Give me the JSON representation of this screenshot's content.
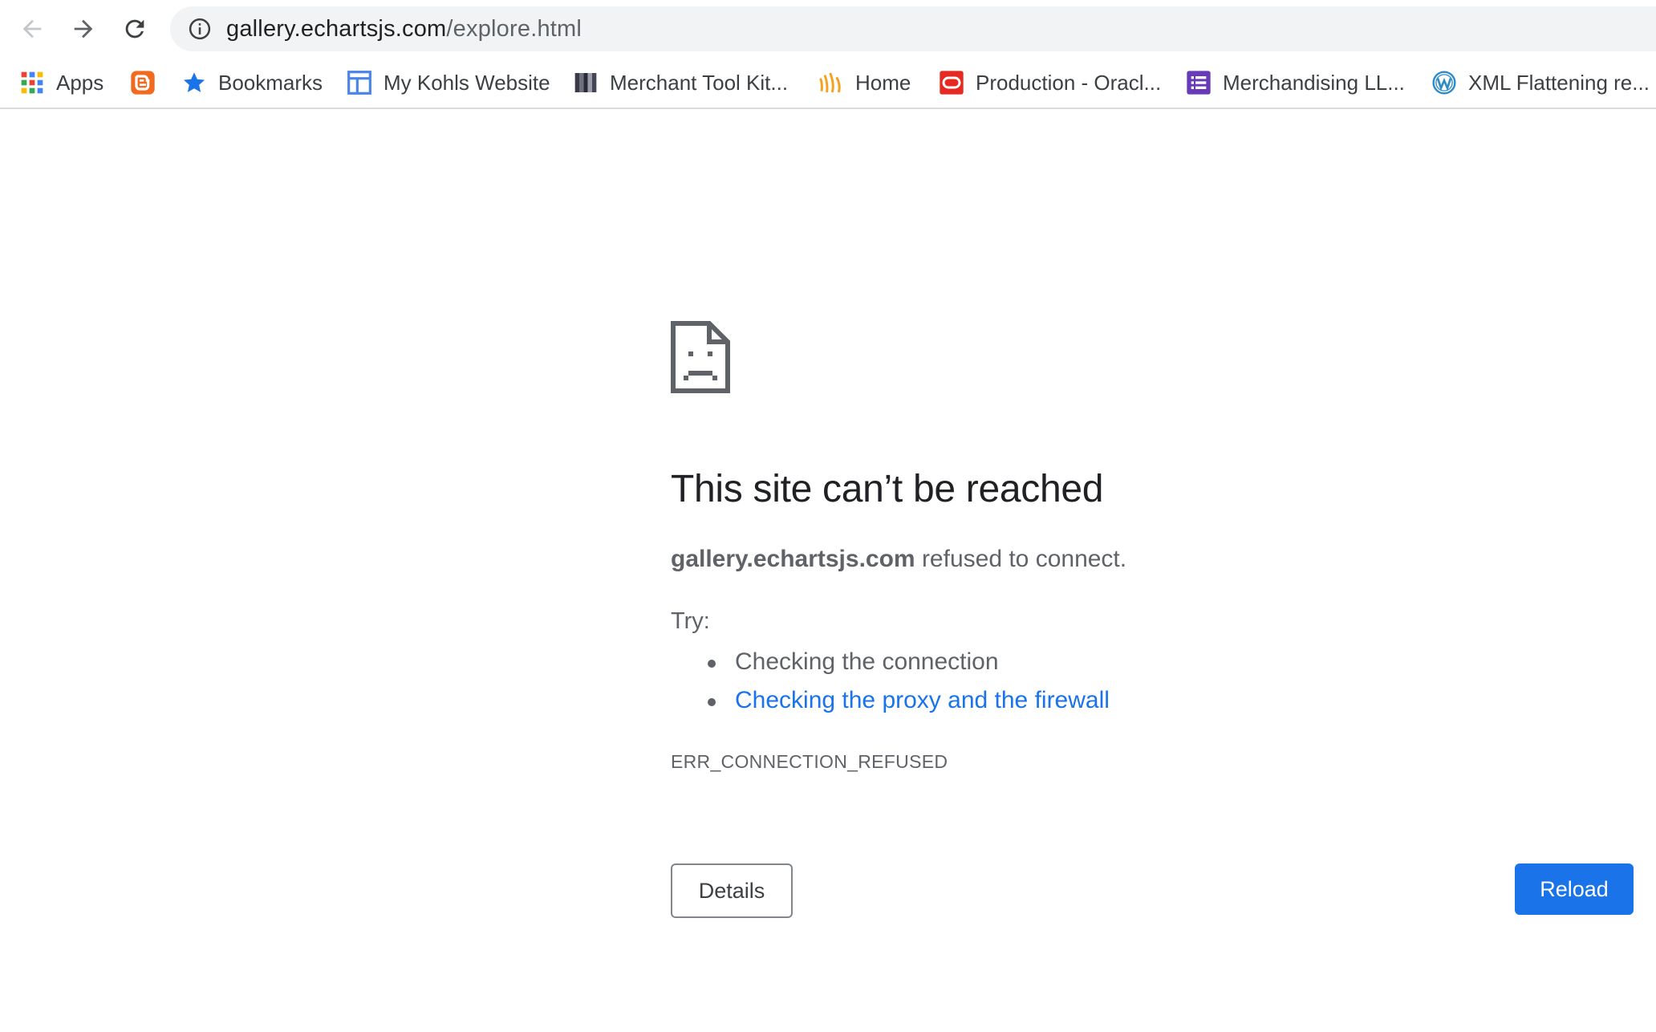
{
  "browser": {
    "url_host": "gallery.echartsjs.com",
    "url_path": "/explore.html"
  },
  "bookmarks": [
    {
      "label": "Apps",
      "icon": "apps-grid-icon"
    },
    {
      "label": "",
      "icon": "blogger-icon",
      "color": "#f26a20"
    },
    {
      "label": "Bookmarks",
      "icon": "star-icon",
      "color": "#1a73e8"
    },
    {
      "label": "My Kohls Website",
      "icon": "layout-icon",
      "color": "#4a86e8"
    },
    {
      "label": "Merchant Tool Kit...",
      "icon": "stripes-icon"
    },
    {
      "label": "Home",
      "icon": "signal-waves-icon",
      "color": "#f4a21b"
    },
    {
      "label": "Production - Oracl...",
      "icon": "oracle-icon",
      "color": "#e42a21"
    },
    {
      "label": "Merchandising LL...",
      "icon": "list-icon",
      "color": "#673ab7"
    },
    {
      "label": "XML Flattening re...",
      "icon": "wordpress-icon",
      "color": "#2d8bc8"
    }
  ],
  "error": {
    "title": "This site can’t be reached",
    "host": "gallery.echartsjs.com",
    "message_rest": " refused to connect.",
    "try_label": "Try:",
    "suggestions": [
      {
        "text": "Checking the connection",
        "is_link": false
      },
      {
        "text": "Checking the proxy and the firewall",
        "is_link": true
      }
    ],
    "code": "ERR_CONNECTION_REFUSED",
    "details_label": "Details",
    "reload_label": "Reload"
  }
}
